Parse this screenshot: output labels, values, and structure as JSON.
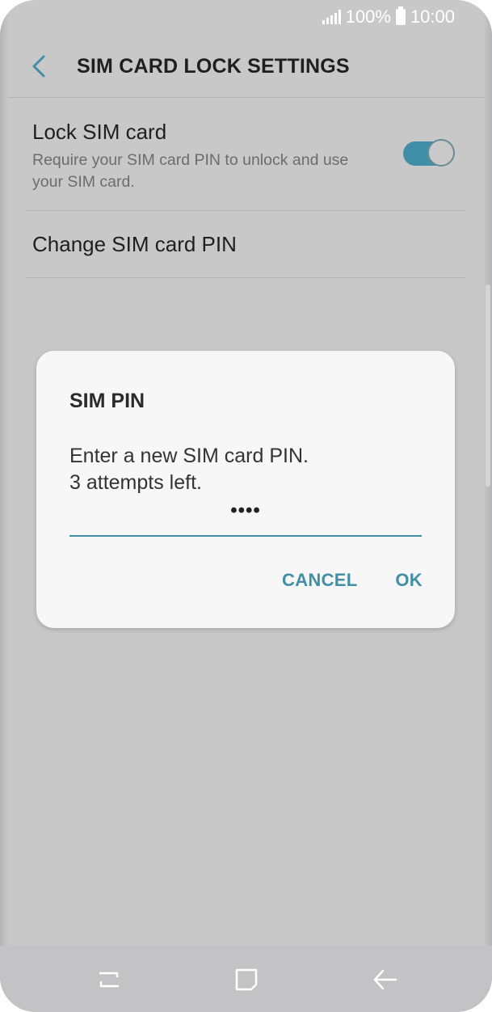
{
  "status_bar": {
    "battery_percent": "100%",
    "time": "10:00"
  },
  "header": {
    "title": "SIM CARD LOCK SETTINGS"
  },
  "settings": {
    "lock_sim": {
      "title": "Lock SIM card",
      "description": "Require your SIM card PIN to unlock and use your SIM card.",
      "enabled": true
    },
    "change_pin": {
      "title": "Change SIM card PIN"
    }
  },
  "dialog": {
    "title": "SIM PIN",
    "message_line1": "Enter a new SIM card PIN.",
    "message_line2": "3 attempts left.",
    "pin_masked": "••••",
    "cancel_label": "CANCEL",
    "ok_label": "OK"
  },
  "colors": {
    "accent": "#3f8fa8",
    "dim_background": "#c8c8c9",
    "dialog_background": "#f7f7f7"
  },
  "icons": {
    "back": "chevron-left-icon",
    "nav_recent": "recent-apps-icon",
    "nav_home": "home-icon",
    "nav_back": "back-arrow-icon"
  }
}
